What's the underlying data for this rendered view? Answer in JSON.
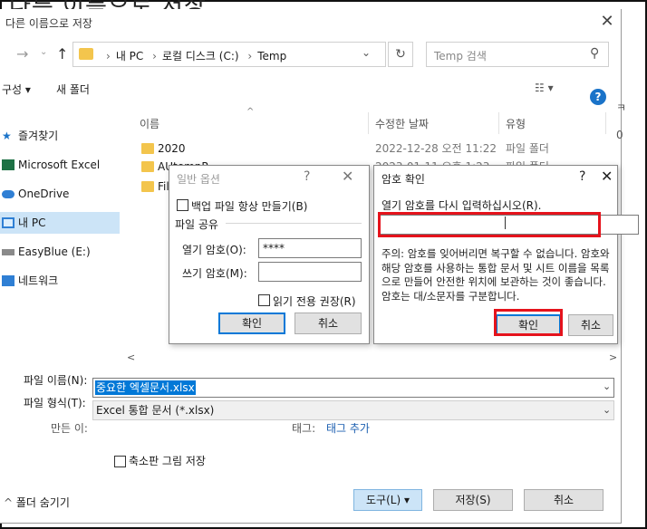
{
  "background_title": "다른 이름으로 저장",
  "dialog": {
    "title": "다른 이름으로 저장",
    "address": {
      "crumbs": [
        "내 PC",
        "로컬 디스크 (C:)",
        "Temp"
      ]
    },
    "search_placeholder": "Temp 검색",
    "toolbar": {
      "organize": "구성",
      "new_folder": "새 폴더"
    },
    "sidebar": [
      {
        "label": "즐겨찾기",
        "icon": "star-icon"
      },
      {
        "label": "Microsoft Excel",
        "icon": "excel-icon"
      },
      {
        "label": "OneDrive",
        "icon": "cloud-icon"
      },
      {
        "label": "내 PC",
        "icon": "pc-icon",
        "selected": true
      },
      {
        "label": "EasyBlue (E:)",
        "icon": "drive-icon"
      },
      {
        "label": "네트워크",
        "icon": "network-icon"
      }
    ],
    "columns": {
      "name": "이름",
      "modified": "수정한 날짜",
      "type": "유형"
    },
    "files": [
      {
        "name": "2020",
        "modified": "2022-12-28 오전 11:22",
        "type": "파일 폴더"
      },
      {
        "name": "AUtempR",
        "modified": "2023-01-11 오후 1:23",
        "type": "파일 폴더"
      },
      {
        "name": "Fil",
        "modified": "",
        "type": ""
      }
    ],
    "filename_label": "파일 이름(N):",
    "filename_value": "중요한 엑셀문서.xlsx",
    "filetype_label": "파일 형식(T):",
    "filetype_value": "Excel 통합 문서 (*.xlsx)",
    "authors_label": "만든 이:",
    "tags_label": "태그:",
    "tags_value": "태그 추가",
    "thumbnail_label": "축소판 그림 저장",
    "hide_folders": "폴더 숨기기",
    "tools_button": "도구(L)",
    "save_button": "저장(S)",
    "cancel_button": "취소"
  },
  "general_options": {
    "title": "일반 옵션",
    "backup_label": "백업 파일 항상 만들기(B)",
    "sharing_label": "파일 공유",
    "open_pw_label": "열기 암호(O):",
    "open_pw_value": "****",
    "modify_pw_label": "쓰기 암호(M):",
    "modify_pw_value": "",
    "readonly_label": "읽기 전용 권장(R)",
    "ok": "확인",
    "cancel": "취소"
  },
  "confirm_password": {
    "title": "암호 확인",
    "prompt": "열기 암호를 다시 입력하십시오(R).",
    "note": "주의: 암호를 잊어버리면 복구할 수 없습니다. 암호와 해당 암호를 사용하는 통합 문서 및 시트 이름을 목록으로 만들어 안전한 위치에 보관하는 것이 좋습니다. 암호는 대/소문자를 구분합니다.",
    "ok": "확인",
    "cancel": "취소"
  },
  "colors": {
    "accent": "#0078d7",
    "highlight": "#e5131c",
    "folder": "#f3c54d",
    "selection": "#cce4f7"
  }
}
